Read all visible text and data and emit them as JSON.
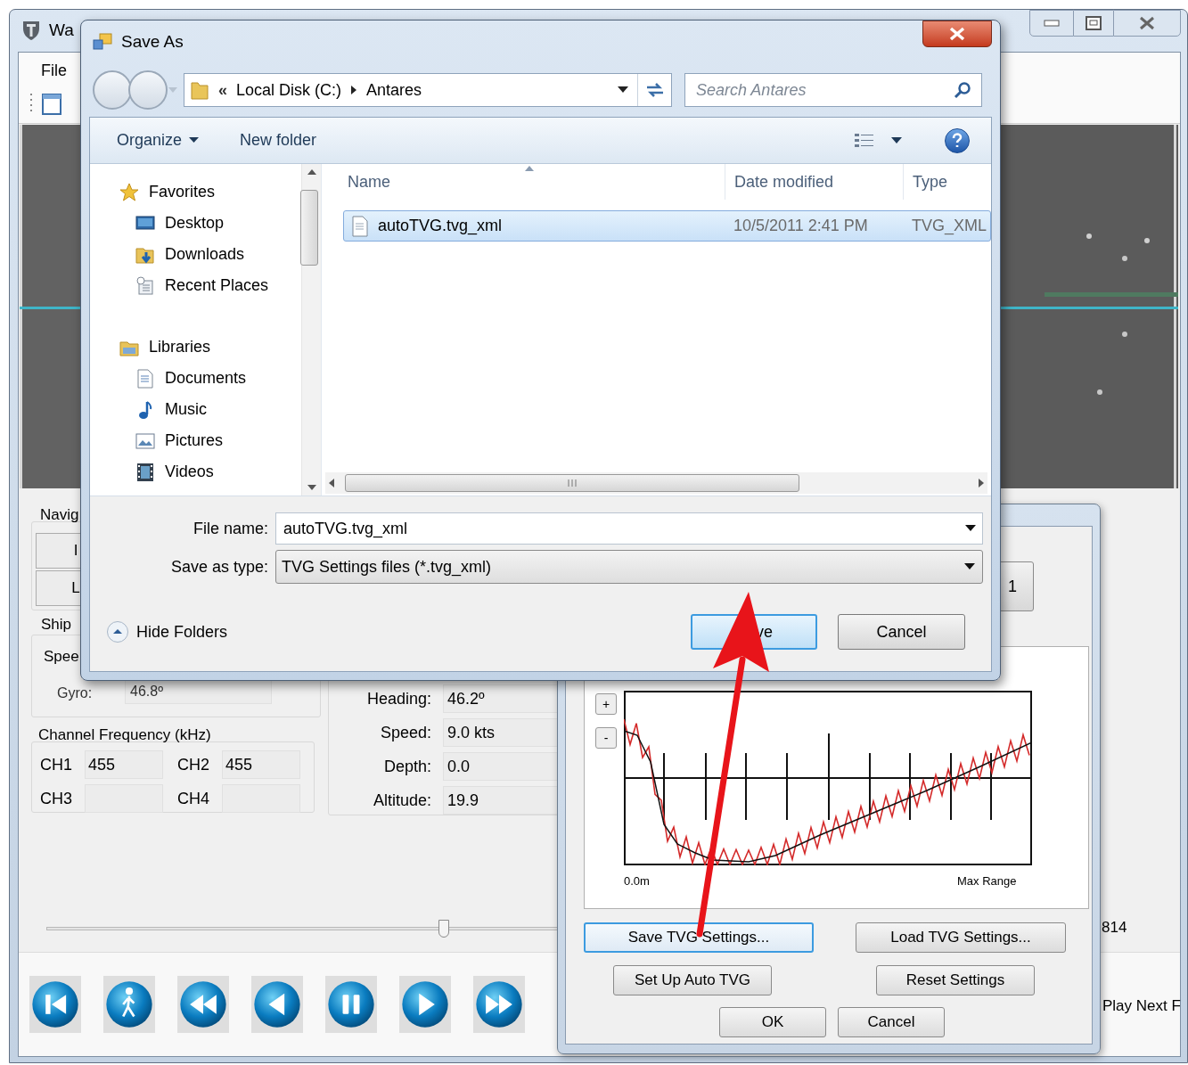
{
  "main_window": {
    "title": "Wa",
    "menu": [
      "File"
    ],
    "navigation_group": {
      "title": "Navig",
      "buttons": [
        "I",
        "L"
      ]
    },
    "ship_group": {
      "title": "Ship",
      "speed_label": "Spee",
      "gyro_label": "Gyro:",
      "gyro_value": "46.8º"
    },
    "channel_frequency": {
      "title": "Channel Frequency (kHz)",
      "channels": [
        {
          "label": "CH1",
          "value": "455"
        },
        {
          "label": "CH2",
          "value": "455"
        },
        {
          "label": "CH3"
        },
        {
          "label": "CH4"
        }
      ]
    },
    "readings": [
      {
        "label": "Heading:",
        "value": "46.2º"
      },
      {
        "label": "Speed:",
        "value": "9.0 kts"
      },
      {
        "label": "Depth:",
        "value": "0.0"
      },
      {
        "label": "Altitude:",
        "value": "19.9"
      }
    ],
    "slider": {
      "level": 0.378
    },
    "position_text": "814",
    "playback_buttons": [
      {
        "kind": "skip-start"
      },
      {
        "kind": "walk"
      },
      {
        "kind": "rewind"
      },
      {
        "kind": "step-back"
      },
      {
        "kind": "pause"
      },
      {
        "kind": "play"
      },
      {
        "kind": "fast-forward"
      }
    ],
    "play_next_label": "Play Next F"
  },
  "tvg_dialog": {
    "partial_button": "1",
    "zoom_buttons": [
      "+",
      "-"
    ],
    "chart_start_label": "0.0m",
    "chart_end_label": "Max Range",
    "buttons": [
      {
        "label": "Save TVG Settings...",
        "focused": true
      },
      {
        "label": "Load TVG Settings...",
        "focused": false
      },
      {
        "label": "Set Up Auto TVG",
        "focused": false
      },
      {
        "label": "Reset Settings",
        "focused": false
      },
      {
        "label": "OK",
        "focused": false
      },
      {
        "label": "Cancel",
        "focused": false
      }
    ]
  },
  "save_as_dialog": {
    "title": "Save As",
    "breadcrumb_overflow": "«",
    "breadcrumb": [
      "Local Disk (C:)",
      "Antares"
    ],
    "search_placeholder": "Search Antares",
    "toolbar": {
      "organize": "Organize",
      "new_folder": "New folder"
    },
    "navigation": [
      {
        "label": "Favorites",
        "kind": "star",
        "children": [
          {
            "label": "Desktop",
            "kind": "desktop"
          },
          {
            "label": "Downloads",
            "kind": "downloads"
          },
          {
            "label": "Recent Places",
            "kind": "recent"
          }
        ]
      },
      {
        "label": "Libraries",
        "kind": "library",
        "children": [
          {
            "label": "Documents",
            "kind": "document"
          },
          {
            "label": "Music",
            "kind": "music"
          },
          {
            "label": "Pictures",
            "kind": "pictures"
          },
          {
            "label": "Videos",
            "kind": "videos"
          }
        ]
      }
    ],
    "columns": [
      "Name",
      "Date modified",
      "Type"
    ],
    "files": [
      {
        "name": "autoTVG.tvg_xml",
        "date_modified": "10/5/2011 2:41 PM",
        "type": "TVG_XML",
        "selected": true
      }
    ],
    "file_name_label": "File name:",
    "file_name": "autoTVG.tvg_xml",
    "save_type_label": "Save as type:",
    "save_type": "TVG Settings files (*.tvg_xml)",
    "hide_folders": "Hide Folders",
    "save_button": "ve",
    "cancel_button": "Cancel"
  }
}
